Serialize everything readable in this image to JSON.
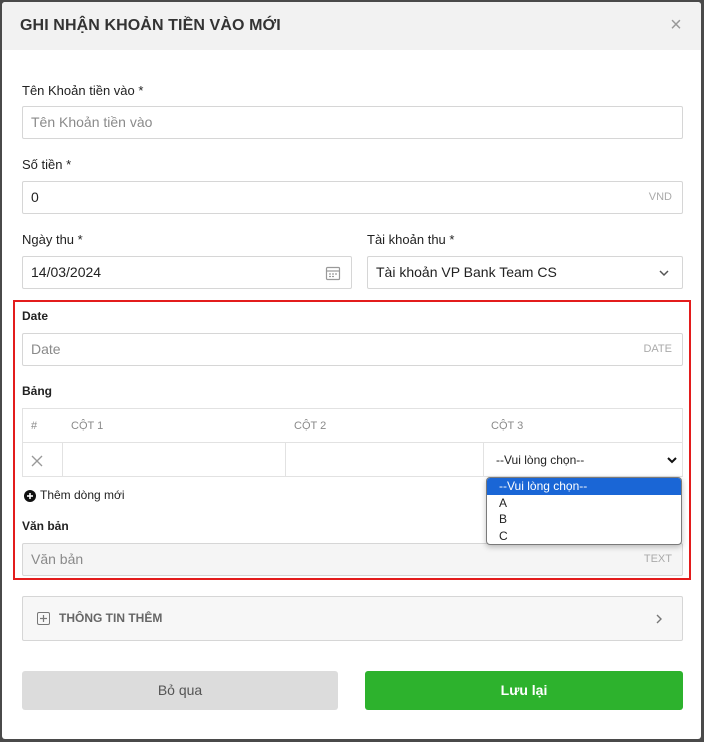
{
  "modal": {
    "title": "GHI NHẬN KHOẢN TIỀN VÀO MỚI",
    "close_symbol": "×"
  },
  "fields": {
    "name": {
      "label": "Tên Khoản tiền vào *",
      "placeholder": "Tên Khoản tiền vào"
    },
    "amount": {
      "label": "Số tiền *",
      "value": "0",
      "suffix": "VND"
    },
    "date_received": {
      "label": "Ngày thu *",
      "value": "14/03/2024"
    },
    "account": {
      "label": "Tài khoản thu *",
      "value": "Tài khoản VP Bank Team CS"
    }
  },
  "custom_fields": {
    "date": {
      "label": "Date",
      "placeholder": "Date",
      "suffix": "DATE"
    },
    "table": {
      "label": "Bảng",
      "columns": [
        "#",
        "CỘT 1",
        "CỘT 2",
        "CỘT 3"
      ],
      "row_select_value": "--Vui lòng chọn--",
      "dropdown_options": [
        "--Vui lòng chọn--",
        "A",
        "B",
        "C"
      ],
      "add_row_label": "Thêm dòng mới"
    },
    "text": {
      "label": "Văn bản",
      "placeholder": "Văn bản",
      "suffix": "TEXT"
    }
  },
  "more_info": {
    "label": "THÔNG TIN THÊM"
  },
  "actions": {
    "cancel_label": "Bỏ qua",
    "save_label": "Lưu lại"
  },
  "colors": {
    "highlight_border": "#e31c1c",
    "save_button": "#2db22d",
    "selected_option": "#1a66d6"
  }
}
